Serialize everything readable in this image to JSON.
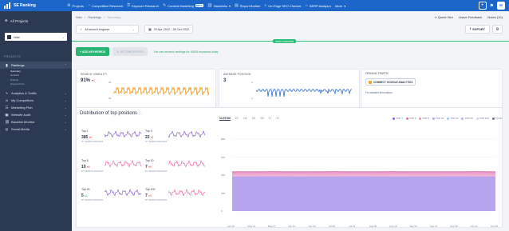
{
  "app": {
    "name": "SE Ranking"
  },
  "topnav": [
    {
      "icon": "gear",
      "label": "Projects"
    },
    {
      "icon": "chart",
      "label": "Competitive Research"
    },
    {
      "icon": "key",
      "label": "Keyword Research"
    },
    {
      "icon": "pen",
      "label": "Content Marketing",
      "badge": "BETA"
    },
    {
      "icon": "link",
      "label": "Backlinks",
      "caret": "▾"
    },
    {
      "icon": "doc",
      "label": "Report Builder"
    },
    {
      "icon": "search",
      "label": "On-Page SEO Checker"
    },
    {
      "icon": "store",
      "label": "SERP Analyzer"
    },
    {
      "icon": "",
      "label": "More",
      "caret": "▾"
    }
  ],
  "topbar_right": {
    "add": "+",
    "flag": "⚑",
    "avatar": "SE"
  },
  "sidebar": {
    "all_projects": "All Projects",
    "project": "Nike",
    "section": "PROJECTS",
    "items": [
      {
        "icon": "rank",
        "label": "Rankings",
        "active": true,
        "subs": [
          "Summary",
          "Detailed",
          "Historic",
          "Keyword Info"
        ]
      },
      {
        "icon": "analytics",
        "label": "Analytics & Traffic"
      },
      {
        "icon": "competitors",
        "label": "My Competitors"
      },
      {
        "icon": "marketing",
        "label": "Marketing Plan"
      },
      {
        "icon": "audit",
        "label": "Website Audit"
      },
      {
        "icon": "backlink",
        "label": "Backlink Monitor"
      },
      {
        "icon": "social",
        "label": "Social Media"
      }
    ]
  },
  "breadcrumb": [
    "Nike",
    "Rankings",
    "Summary"
  ],
  "header_links": [
    "Quest Hint",
    "Leave Feedback",
    "Notes (10)"
  ],
  "filters": {
    "engine": "All search engines",
    "date": "29 Apr 2022 - 28 Oct 2022"
  },
  "export_label": "EXPORT",
  "status_pill": "100% CHECKED",
  "actions": {
    "add": "+ ADD KEYWORDS",
    "recheck": "RE-CHECK KEYS",
    "note": "You can recheck rankings for 43635 keywords today"
  },
  "kpi": {
    "visibility": {
      "title": "SEARCH VISIBILITY",
      "value": "91%",
      "delta": "▾1",
      "y_top": "91",
      "y_bottom": "95"
    },
    "position": {
      "title": "AVERAGE POSITION",
      "value": "3",
      "y_top": "3",
      "y_bottom": "2"
    },
    "traffic": {
      "title": "ORGANIC TRAFFIC",
      "button": "CONNECT GOOGLE ANALYTICS",
      "note": "For detailed information"
    }
  },
  "distribution": {
    "title": "Distribution of top positions",
    "cards": [
      {
        "title": "Top 1",
        "value": "385",
        "delta": "▾6",
        "up": false,
        "sub": "BY SEARCH ENGINES",
        "color": "#8a63d2"
      },
      {
        "title": "Top 3",
        "value": "22",
        "delta": "▾1",
        "up": false,
        "sub": "BY SEARCH ENGINES",
        "color": "#8a63d2"
      },
      {
        "title": "Top 5",
        "value": "10",
        "delta": "▾0",
        "up": false,
        "sub": "BY SEARCH ENGINES",
        "color": "#e96ba8"
      },
      {
        "title": "Top 10",
        "value": "7",
        "delta": "▾0",
        "up": false,
        "sub": "BY SEARCH ENGINES",
        "color": "#e96ba8"
      },
      {
        "title": "Top 20",
        "value": "5",
        "delta": "▴1",
        "up": true,
        "sub": "BY SEARCH ENGINES",
        "color": "#8a63d2"
      },
      {
        "title": "Top 100",
        "value": "7",
        "delta": "▾0",
        "up": false,
        "sub": "BY SEARCH ENGINES",
        "color": "#e96ba8"
      }
    ],
    "ranges": [
      "CUSTOM",
      "1D",
      "1W",
      "1M",
      "3M",
      "1Y",
      "2Y"
    ],
    "legend": [
      {
        "name": "TOP 1",
        "color": "#8a63d2"
      },
      {
        "name": "TOP 3",
        "color": "#e96ba8"
      },
      {
        "name": "TOP 5",
        "color": "#f08fbd"
      },
      {
        "name": "TOP 10",
        "color": "#c8aaf0"
      },
      {
        "name": "TOP 20",
        "color": "#9cc7f2"
      },
      {
        "name": "TOP 50",
        "color": "#b9b0e8"
      },
      {
        "name": "TOP 100",
        "color": "#d8d1f4"
      },
      {
        "name": "TOTAL",
        "color": "#6b7a90"
      }
    ],
    "y_ticks": [
      "800",
      "600",
      "400",
      "200",
      "0"
    ],
    "x_ticks": [
      "Apr 29",
      "May 13",
      "May 27",
      "Jun 10",
      "Jun 24",
      "Jul 08",
      "Jul 22",
      "Aug 05",
      "Aug 19",
      "Sep 02",
      "Sep 16",
      "Sep 30",
      "Oct 14",
      "Oct 28"
    ]
  },
  "chart_data": {
    "type": "area",
    "x": [
      "Apr 29",
      "May 13",
      "May 27",
      "Jun 10",
      "Jun 24",
      "Jul 08",
      "Jul 22",
      "Aug 05",
      "Aug 19",
      "Sep 02",
      "Sep 16",
      "Sep 30",
      "Oct 14",
      "Oct 28"
    ],
    "ylim": [
      0,
      800
    ],
    "series": [
      {
        "name": "TOP 1",
        "values": [
          385,
          385,
          386,
          385,
          384,
          385,
          386,
          385,
          385,
          384,
          385,
          386,
          385,
          385
        ]
      },
      {
        "name": "TOP 3",
        "values": [
          407,
          406,
          407,
          408,
          407,
          407,
          406,
          407,
          408,
          407,
          406,
          407,
          407,
          407
        ]
      },
      {
        "name": "TOP 100",
        "values": [
          436,
          436,
          437,
          436,
          436,
          437,
          436,
          436,
          437,
          436,
          436,
          436,
          437,
          436
        ]
      }
    ]
  },
  "colors": {
    "brand": "#1c66c9",
    "sidebar": "#2b3a52",
    "accent_green": "#29b573",
    "negative": "#e14b4b"
  }
}
